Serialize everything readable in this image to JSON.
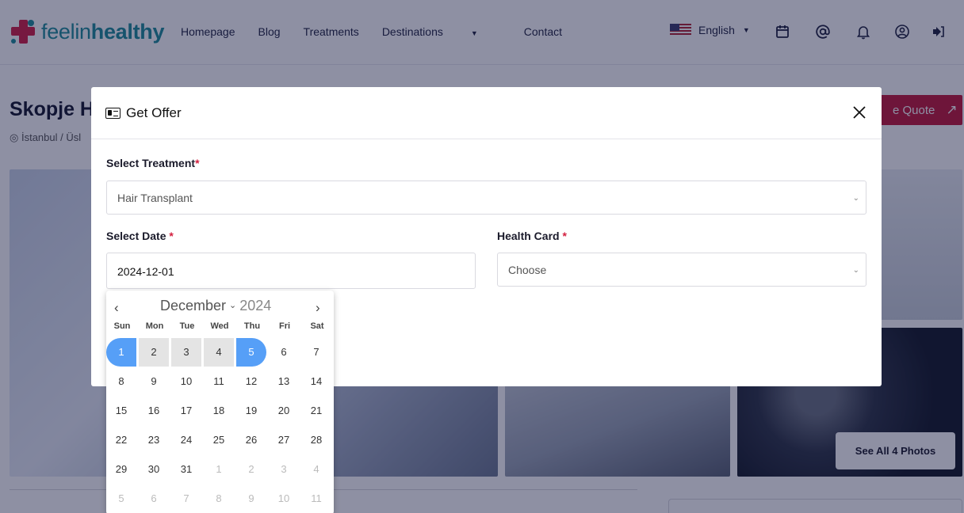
{
  "header": {
    "logo_part1": "feelin",
    "logo_part2": "healthy",
    "nav": [
      {
        "label": "Homepage"
      },
      {
        "label": "Blog"
      },
      {
        "label": "Treatments"
      },
      {
        "label": "Destinations",
        "dropdown": true
      },
      {
        "label": "Contact"
      }
    ],
    "language": "English",
    "icons": [
      "calendar-icon",
      "at-icon",
      "bell-icon",
      "user-icon",
      "logout-icon"
    ]
  },
  "page": {
    "title": "Skopje H",
    "location": "İstanbul / Üsl",
    "quote_button": "e Quote",
    "see_all_photos": "See All 4 Photos"
  },
  "modal": {
    "title": "Get Offer",
    "treatment_label": "Select Treatment",
    "treatment_value": "Hair Transplant",
    "date_label": "Select Date",
    "date_value": "2024-12-01",
    "health_card_label": "Health Card",
    "health_card_placeholder": "Choose",
    "required_mark": "*"
  },
  "calendar": {
    "month": "December",
    "year": "2024",
    "weekdays": [
      "Sun",
      "Mon",
      "Tue",
      "Wed",
      "Thu",
      "Fri",
      "Sat"
    ],
    "weeks": [
      [
        "1",
        "2",
        "3",
        "4",
        "5",
        "6",
        "7"
      ],
      [
        "8",
        "9",
        "10",
        "11",
        "12",
        "13",
        "14"
      ],
      [
        "15",
        "16",
        "17",
        "18",
        "19",
        "20",
        "21"
      ],
      [
        "22",
        "23",
        "24",
        "25",
        "26",
        "27",
        "28"
      ],
      [
        "29",
        "30",
        "31",
        "1",
        "2",
        "3",
        "4"
      ],
      [
        "5",
        "6",
        "7",
        "8",
        "9",
        "10",
        "11"
      ]
    ],
    "range_start": "1",
    "range_end": "5"
  },
  "colors": {
    "brand_teal": "#1d8d9a",
    "brand_red": "#c3173a",
    "selected_blue": "#569ff7",
    "overlay": "#0e143c"
  }
}
